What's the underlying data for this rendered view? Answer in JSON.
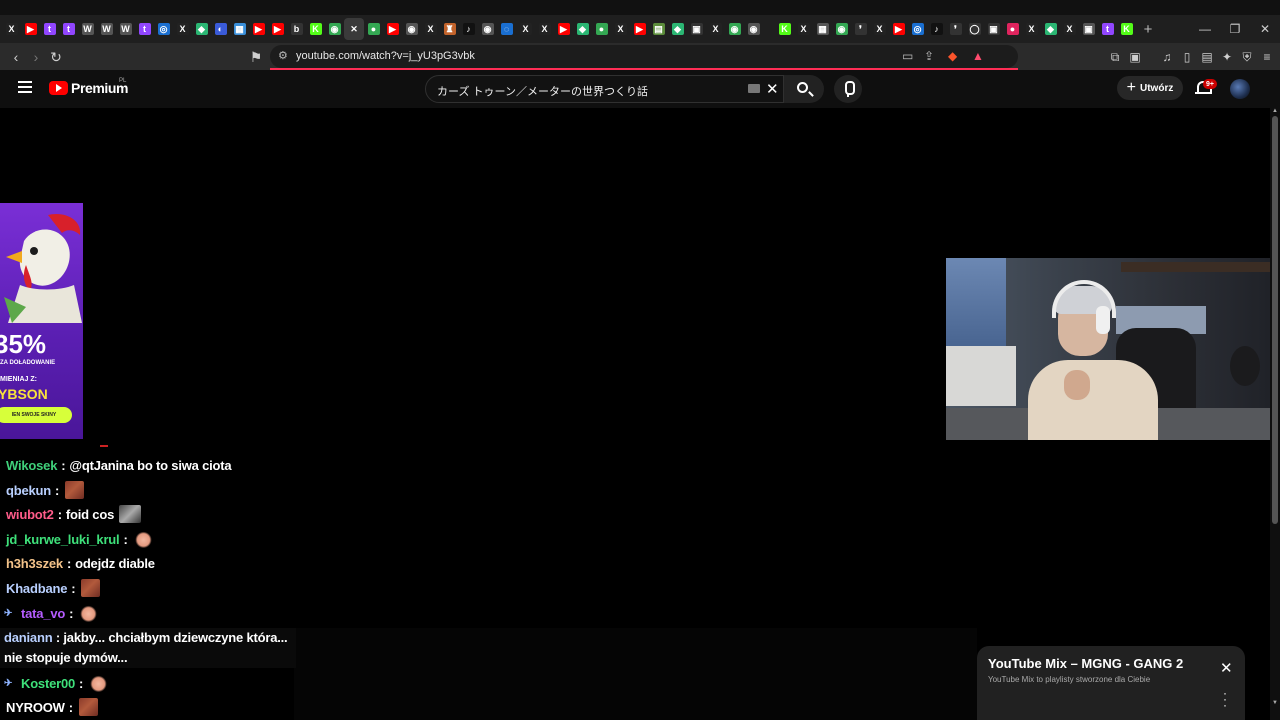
{
  "browser": {
    "tabs": [
      {
        "icon": "x-icon",
        "glyph": "X",
        "color": "#222"
      },
      {
        "icon": "youtube-icon",
        "glyph": "▶",
        "color": "#ff0000"
      },
      {
        "icon": "twitch-icon",
        "glyph": "t",
        "color": "#9146ff"
      },
      {
        "icon": "twitch-icon",
        "glyph": "t",
        "color": "#9146ff"
      },
      {
        "icon": "wykop-icon",
        "glyph": "W",
        "color": "#555"
      },
      {
        "icon": "wykop-icon",
        "glyph": "W",
        "color": "#555"
      },
      {
        "icon": "wykop-icon",
        "glyph": "W",
        "color": "#555"
      },
      {
        "icon": "twitch-icon",
        "glyph": "t",
        "color": "#9146ff"
      },
      {
        "icon": "site-icon",
        "glyph": "◎",
        "color": "#1a6fd1"
      },
      {
        "icon": "x-icon",
        "glyph": "X",
        "color": "#222"
      },
      {
        "icon": "site-icon",
        "glyph": "◆",
        "color": "#2bb673"
      },
      {
        "icon": "site-icon",
        "glyph": "◐",
        "color": "#3a5bd9"
      },
      {
        "icon": "site-icon",
        "glyph": "▦",
        "color": "#3a8fd9"
      },
      {
        "icon": "youtube-icon",
        "glyph": "▶",
        "color": "#ff0000"
      },
      {
        "icon": "youtube-icon",
        "glyph": "▶",
        "color": "#ff0000"
      },
      {
        "icon": "site-icon",
        "glyph": "b",
        "color": "#333"
      },
      {
        "icon": "kick-icon",
        "glyph": "K",
        "color": "#53fc18"
      },
      {
        "icon": "chrome-icon",
        "glyph": "◉",
        "color": "#34a853"
      },
      {
        "icon": "close-icon",
        "glyph": "✕",
        "color": "#3a3a3a"
      },
      {
        "icon": "maps-icon",
        "glyph": "●",
        "color": "#34a853"
      },
      {
        "icon": "youtube-icon",
        "glyph": "▶",
        "color": "#ff0000"
      },
      {
        "icon": "site-icon",
        "glyph": "◉",
        "color": "#555"
      },
      {
        "icon": "x-icon",
        "glyph": "X",
        "color": "#222"
      },
      {
        "icon": "site-icon",
        "glyph": "♜",
        "color": "#c2632b"
      },
      {
        "icon": "tiktok-icon",
        "glyph": "♪",
        "color": "#111"
      },
      {
        "icon": "site-icon",
        "glyph": "◉",
        "color": "#555"
      },
      {
        "icon": "site-icon",
        "glyph": "◌",
        "color": "#1a6fd1"
      },
      {
        "icon": "x-icon",
        "glyph": "X",
        "color": "#222"
      },
      {
        "icon": "x-icon",
        "glyph": "X",
        "color": "#222"
      },
      {
        "icon": "youtube-icon",
        "glyph": "▶",
        "color": "#ff0000"
      },
      {
        "icon": "site-icon",
        "glyph": "◆",
        "color": "#2bb673"
      },
      {
        "icon": "maps-icon",
        "glyph": "●",
        "color": "#34a853"
      },
      {
        "icon": "x-icon",
        "glyph": "X",
        "color": "#222"
      },
      {
        "icon": "youtube-icon",
        "glyph": "▶",
        "color": "#ff0000"
      },
      {
        "icon": "site-icon",
        "glyph": "▤",
        "color": "#5b8c3a"
      },
      {
        "icon": "site-icon",
        "glyph": "◆",
        "color": "#2bb673"
      },
      {
        "icon": "site-icon",
        "glyph": "▣",
        "color": "#333"
      },
      {
        "icon": "x-icon",
        "glyph": "X",
        "color": "#222"
      },
      {
        "icon": "chrome-icon",
        "glyph": "◉",
        "color": "#34a853"
      },
      {
        "icon": "site-icon",
        "glyph": "◉",
        "color": "#555"
      }
    ],
    "tabs2": [
      {
        "icon": "kick-icon",
        "glyph": "K",
        "color": "#53fc18"
      },
      {
        "icon": "x-icon",
        "glyph": "X",
        "color": "#222"
      },
      {
        "icon": "site-icon",
        "glyph": "▦",
        "color": "#555"
      },
      {
        "icon": "chrome-icon",
        "glyph": "◉",
        "color": "#34a853"
      },
      {
        "icon": "site-icon",
        "glyph": "❜",
        "color": "#333"
      },
      {
        "icon": "x-icon",
        "glyph": "X",
        "color": "#222"
      },
      {
        "icon": "youtube-icon",
        "glyph": "▶",
        "color": "#ff0000"
      },
      {
        "icon": "site-icon",
        "glyph": "◎",
        "color": "#1a6fd1"
      },
      {
        "icon": "tiktok-icon",
        "glyph": "♪",
        "color": "#111"
      },
      {
        "icon": "site-icon",
        "glyph": "❜",
        "color": "#333"
      },
      {
        "icon": "site-icon",
        "glyph": "◯",
        "color": "#333"
      },
      {
        "icon": "site-icon",
        "glyph": "▣",
        "color": "#333"
      },
      {
        "icon": "site-icon",
        "glyph": "●",
        "color": "#e0245e"
      },
      {
        "icon": "x-icon",
        "glyph": "X",
        "color": "#222"
      },
      {
        "icon": "site-icon",
        "glyph": "◆",
        "color": "#2bb673"
      },
      {
        "icon": "x-icon",
        "glyph": "X",
        "color": "#222"
      },
      {
        "icon": "site-icon",
        "glyph": "▣",
        "color": "#555"
      },
      {
        "icon": "twitch-icon",
        "glyph": "t",
        "color": "#9146ff"
      },
      {
        "icon": "kick-icon",
        "glyph": "K",
        "color": "#53fc18"
      }
    ],
    "url": "youtube.com/watch?v=j_yU3pG3vbk"
  },
  "youtube": {
    "brand": "Premium",
    "region": "PL",
    "search_query": "カーズ トゥーン／メーターの世界つくり話",
    "create_label": "Utwórz",
    "notif_count": "9+"
  },
  "ad": {
    "percent": "35%",
    "line1": "ZA DOŁADOWANIE",
    "line2": "MIENIAJ Z:",
    "brand": "YBSON",
    "cta": "IEN SWOJE SKINY"
  },
  "chat": {
    "messages": [
      {
        "user": "Wikosek",
        "color": "#3fd07a",
        "text": "@qtJanina bo to siwa ciota",
        "emote": null,
        "badge": false
      },
      {
        "user": "qbekun",
        "color": "#b9d0ff",
        "text": "",
        "emote": "brick",
        "badge": false
      },
      {
        "user": "wiubot2",
        "color": "#ff5c8a",
        "text": "foid cos",
        "emote": "cat",
        "badge": false
      },
      {
        "user": "jd_kurwe_luki_krul",
        "color": "#3ee07a",
        "text": "",
        "emote": "hand",
        "badge": false
      },
      {
        "user": "h3h3szek",
        "color": "#f4c38a",
        "text": "odejdz diable",
        "emote": null,
        "badge": false
      },
      {
        "user": "Khadbane",
        "color": "#b9d0ff",
        "text": "",
        "emote": "brick",
        "badge": false
      },
      {
        "user": "tata_vo",
        "color": "#b55cff",
        "text": "",
        "emote": "hand",
        "badge": true
      },
      {
        "user": "daniann",
        "color": "#b9d0ff",
        "text": "jakby... chciałbym dziewczyne która...",
        "emote": null,
        "badge": false
      },
      {
        "user": "Koster00",
        "color": "#3ee07a",
        "text": "",
        "emote": "hand",
        "badge": true
      },
      {
        "user": "NYROOW",
        "color": "#ffffff",
        "text": "",
        "emote": "brick",
        "badge": false
      }
    ],
    "wrap_continuation": "nie stopuje dymów..."
  },
  "mix": {
    "title": "YouTube Mix – MGNG - GANG 2",
    "subtitle": "YouTube Mix to playlisty stworzone dla Ciebie"
  }
}
